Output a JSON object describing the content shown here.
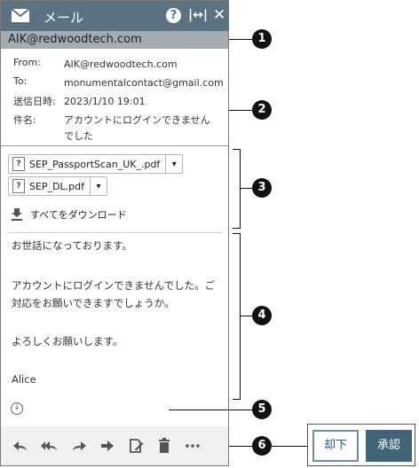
{
  "header": {
    "title": "メール"
  },
  "sender_bar": "AIK@redwoodtech.com",
  "meta": {
    "from_label": "From:",
    "from": "AIK@redwoodtech.com",
    "to_label": "To:",
    "to": "monumentalcontact@gmail.com",
    "sent_label": "送信日時:",
    "sent": "2023/1/10 19:01",
    "subject_label": "件名:",
    "subject_line1": "アカウントにログインできません",
    "subject_line2": "でした"
  },
  "attachments": [
    {
      "name": "SEP_PassportScan_UK_.pdf"
    },
    {
      "name": "SEP_DL.pdf"
    }
  ],
  "download_all": "すべてをダウンロード",
  "body": {
    "line1": "お世話になっております。",
    "line2": "アカウントにログインできませんでした。ご",
    "line3": "対応をお願いできますでしょうか。",
    "line4": "よろしくお願いします。",
    "line5": "Alice"
  },
  "callouts": [
    "1",
    "2",
    "3",
    "4",
    "5",
    "6"
  ],
  "actions": {
    "reject": "却下",
    "approve": "承認"
  },
  "icons": [
    "mail-icon",
    "help-icon",
    "expand-width-icon",
    "close-icon",
    "file-icon",
    "chevron-down-icon",
    "download-icon",
    "signature-icon",
    "reply-icon",
    "reply-all-icon",
    "forward-icon",
    "move-icon",
    "edit-icon",
    "delete-icon",
    "more-icon"
  ]
}
